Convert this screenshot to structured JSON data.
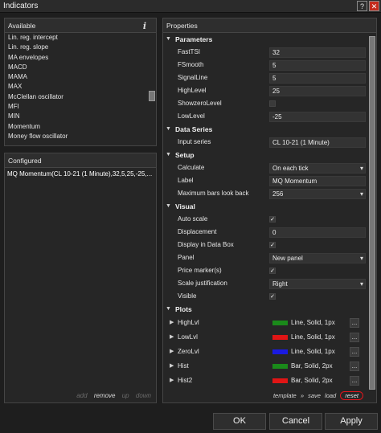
{
  "window": {
    "title": "Indicators",
    "help_label": "?",
    "close_label": "✕"
  },
  "available": {
    "header": "Available",
    "info_label": "i",
    "items": [
      "Lin. reg. intercept",
      "Lin. reg. slope",
      "MA envelopes",
      "MACD",
      "MAMA",
      "MAX",
      "McClellan oscillator",
      "MFI",
      "MIN",
      "Momentum",
      "Money flow oscillator"
    ]
  },
  "configured": {
    "header": "Configured",
    "items": [
      "MQ Momentum(CL 10-21 (1 Minute),32,5,25,-25,..."
    ],
    "actions": {
      "add": "add",
      "remove": "remove",
      "up": "up",
      "down": "down"
    }
  },
  "properties": {
    "header": "Properties",
    "parameters": {
      "label": "Parameters",
      "rows": [
        {
          "label": "FastTSI",
          "value": "32"
        },
        {
          "label": "FSmooth",
          "value": "5"
        },
        {
          "label": "SignalLine",
          "value": "5"
        },
        {
          "label": "HighLevel",
          "value": "25"
        },
        {
          "label": "ShowzeroLevel",
          "checked": false
        },
        {
          "label": "LowLevel",
          "value": "-25"
        }
      ]
    },
    "data_series": {
      "label": "Data Series",
      "input_series_label": "Input series",
      "input_series_value": "CL 10-21 (1 Minute)"
    },
    "setup": {
      "label": "Setup",
      "calculate_label": "Calculate",
      "calculate_value": "On each tick",
      "label_label": "Label",
      "label_value": "MQ Momentum",
      "max_bars_label": "Maximum bars look back",
      "max_bars_value": "256"
    },
    "visual": {
      "label": "Visual",
      "auto_scale_label": "Auto scale",
      "auto_scale": true,
      "displacement_label": "Displacement",
      "displacement_value": "0",
      "display_data_box_label": "Display in Data Box",
      "display_data_box": true,
      "panel_label": "Panel",
      "panel_value": "New panel",
      "price_markers_label": "Price marker(s)",
      "price_markers": true,
      "scale_just_label": "Scale justification",
      "scale_just_value": "Right",
      "visible_label": "Visible",
      "visible": true
    },
    "plots": {
      "label": "Plots",
      "items": [
        {
          "name": "HighLvl",
          "desc": "Line, Solid, 1px",
          "color": "#1a8a1a"
        },
        {
          "name": "LowLvl",
          "desc": "Line, Solid, 1px",
          "color": "#e01515"
        },
        {
          "name": "ZeroLvl",
          "desc": "Line, Solid, 1px",
          "color": "#1a1ae0"
        },
        {
          "name": "Hist",
          "desc": "Bar, Solid, 2px",
          "color": "#1a8a1a"
        },
        {
          "name": "Hist2",
          "desc": "Bar, Solid, 2px",
          "color": "#e01515"
        }
      ],
      "more_label": "..."
    },
    "footer": {
      "template": "template",
      "sep": "»",
      "save": "save",
      "load": "load",
      "reset": "reset"
    }
  },
  "buttons": {
    "ok": "OK",
    "cancel": "Cancel",
    "apply": "Apply"
  }
}
